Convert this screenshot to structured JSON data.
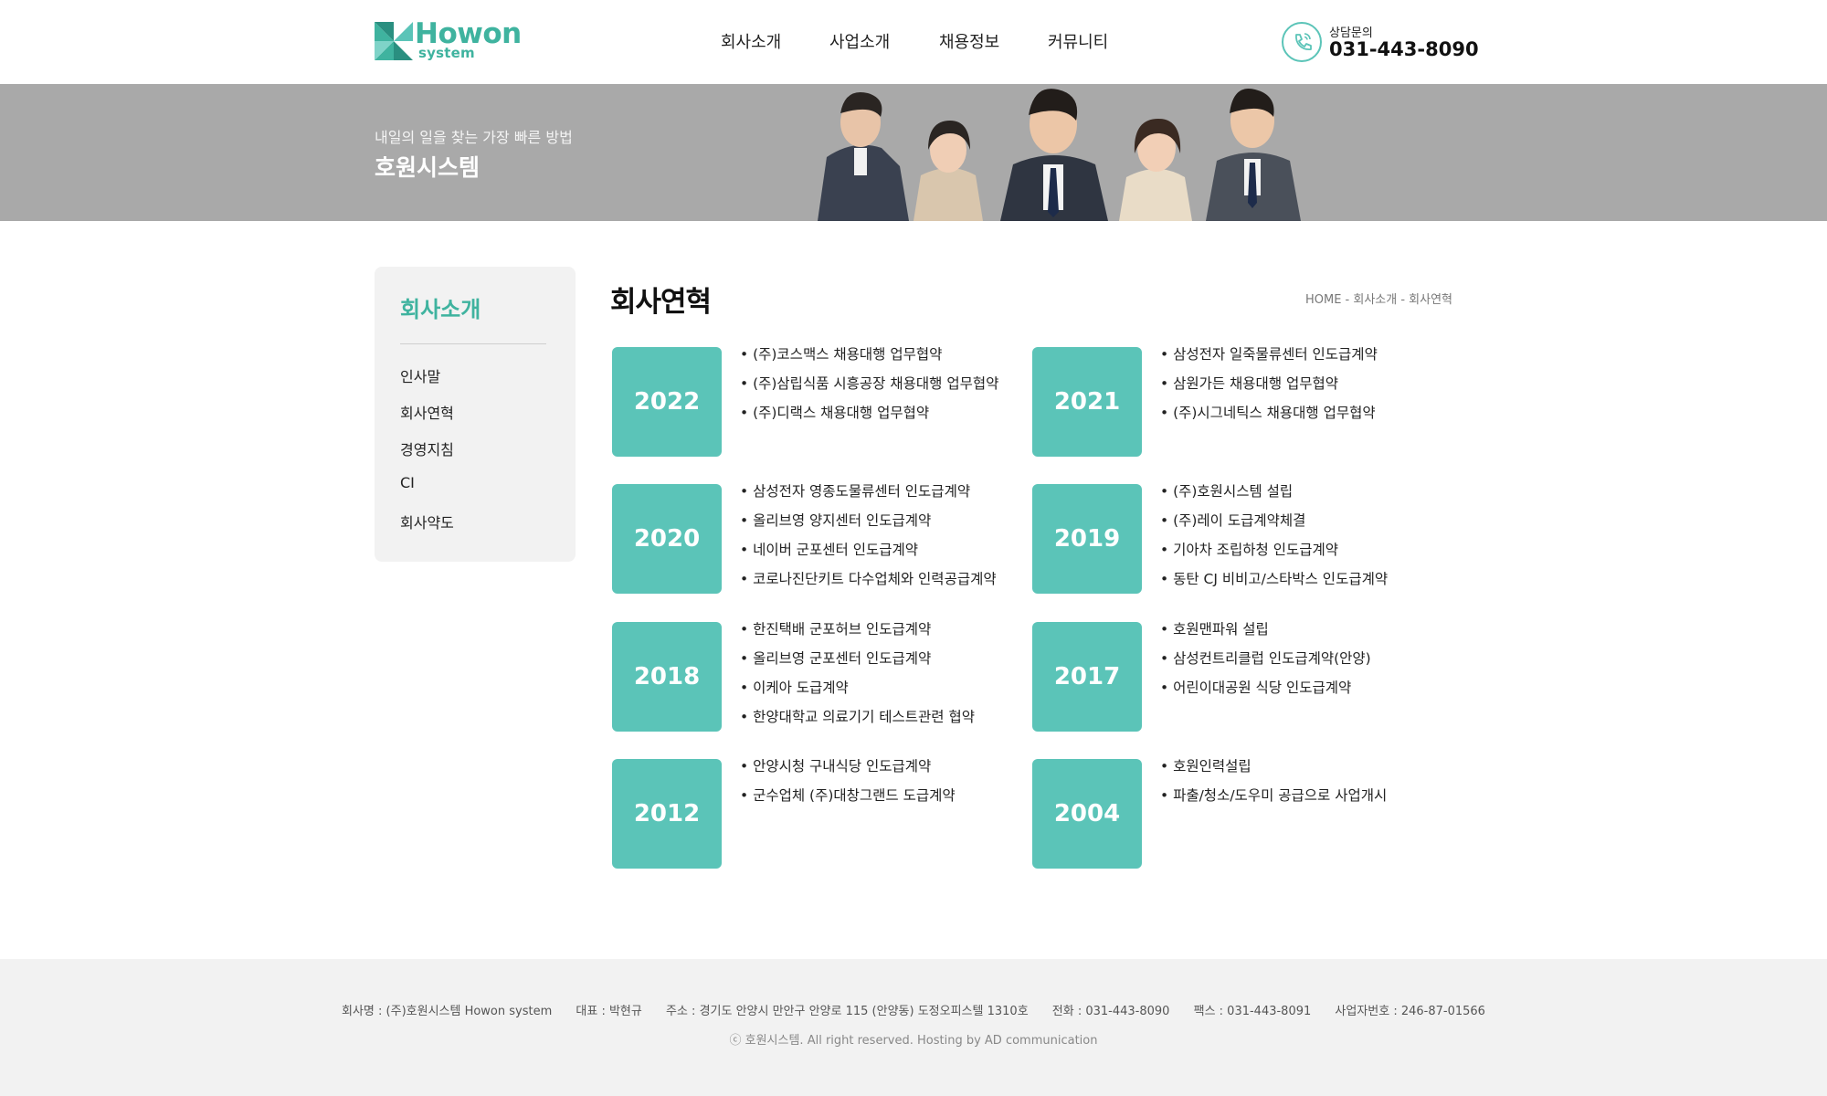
{
  "header": {
    "logo_word": "Howon",
    "logo_sub": "system",
    "nav": [
      "회사소개",
      "사업소개",
      "채용정보",
      "커뮤니티"
    ],
    "phone_label": "상담문의",
    "phone_number": "031-443-8090"
  },
  "banner": {
    "subtitle": "내일의 일을 찾는 가장 빠른 방법",
    "title": "호원시스템"
  },
  "sidebar": {
    "title": "회사소개",
    "items": [
      "인사말",
      "회사연혁",
      "경영지침",
      "CI",
      "회사약도"
    ]
  },
  "main": {
    "title": "회사연혁",
    "breadcrumb": "HOME - 회사소개 - 회사연혁"
  },
  "history": [
    {
      "year": "2022",
      "items": [
        "• (주)코스맥스 채용대행 업무협약",
        "• (주)삼립식품 시흥공장 채용대행 업무협약",
        "• (주)디랙스 채용대행 업무협약"
      ]
    },
    {
      "year": "2021",
      "items": [
        "• 삼성전자 일죽물류센터 인도급계약",
        "• 삼원가든 채용대행 업무협약",
        "• (주)시그네틱스 채용대행 업무협약"
      ]
    },
    {
      "year": "2020",
      "items": [
        "• 삼성전자 영종도물류센터 인도급계약",
        "• 올리브영 양지센터 인도급계약",
        "• 네이버 군포센터 인도급계약",
        "• 코로나진단키트 다수업체와 인력공급계약"
      ]
    },
    {
      "year": "2019",
      "items": [
        "• (주)호원시스템 설립",
        "• (주)레이 도급계약체결",
        "• 기아차 조립하청 인도급계약",
        "• 동탄 CJ 비비고/스타박스 인도급계약"
      ]
    },
    {
      "year": "2018",
      "items": [
        "• 한진택배 군포허브 인도급계약",
        "• 올리브영 군포센터 인도급계약",
        "• 이케아 도급계약",
        "• 한양대학교 의료기기 테스트관련 협약"
      ]
    },
    {
      "year": "2017",
      "items": [
        "• 호원맨파워 설립",
        "• 삼성컨트리클럽 인도급계약(안양)",
        "• 어린이대공원 식당 인도급계약"
      ]
    },
    {
      "year": "2012",
      "items": [
        "• 안양시청 구내식당 인도급계약",
        "• 군수업체 (주)대창그랜드 도급계약"
      ]
    },
    {
      "year": "2004",
      "items": [
        "• 호원인력설립",
        "• 파출/청소/도우미 공급으로 사업개시"
      ]
    }
  ],
  "footer": {
    "info": [
      "회사명 : (주)호원시스템 Howon system",
      "대표 : 박현규",
      "주소 : 경기도 안양시 만안구 안양로 115 (안양동) 도정오피스텔 1310호",
      "전화 : 031-443-8090",
      "팩스 : 031-443-8091",
      "사업자번호 : 246-87-01566"
    ],
    "copyright": "ⓒ 호원시스템. All right reserved. Hosting by AD communication"
  },
  "colors": {
    "accent": "#5bc4b8",
    "accent_text": "#3fb39f",
    "banner_bg": "#a9a9a9",
    "panel_bg": "#f2f2f2"
  }
}
